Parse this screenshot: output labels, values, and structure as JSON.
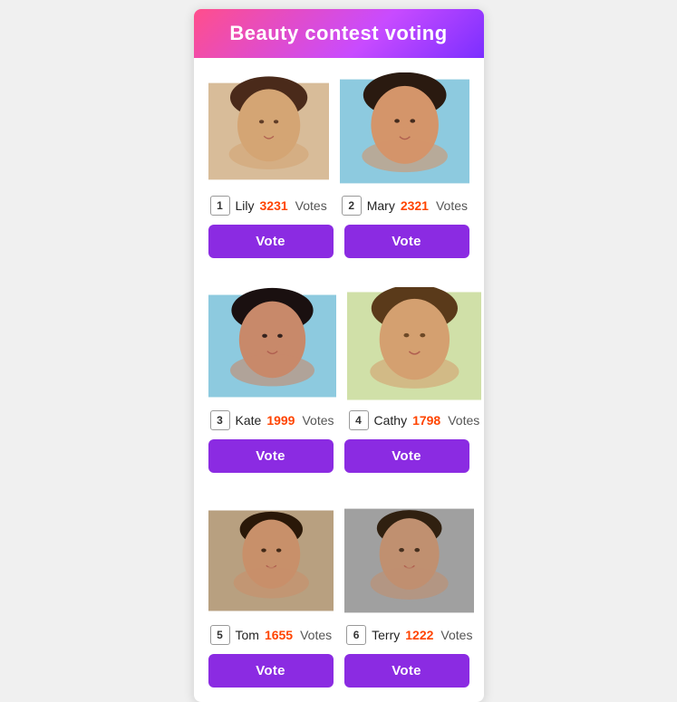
{
  "header": {
    "title": "Beauty contest voting",
    "gradient_start": "#ff4e8c",
    "gradient_end": "#7b2fff"
  },
  "candidates": [
    {
      "id": 1,
      "name": "Lily",
      "votes": 3231,
      "votes_label": "Votes",
      "photo_class": "photo-lily"
    },
    {
      "id": 2,
      "name": "Mary",
      "votes": 2321,
      "votes_label": "Votes",
      "photo_class": "photo-mary"
    },
    {
      "id": 3,
      "name": "Kate",
      "votes": 1999,
      "votes_label": "Votes",
      "photo_class": "photo-kate"
    },
    {
      "id": 4,
      "name": "Cathy",
      "votes": 1798,
      "votes_label": "Votes",
      "photo_class": "photo-cathy"
    },
    {
      "id": 5,
      "name": "Tom",
      "votes": 1655,
      "votes_label": "Votes",
      "photo_class": "photo-tom"
    },
    {
      "id": 6,
      "name": "Terry",
      "votes": 1222,
      "votes_label": "Votes",
      "photo_class": "photo-terry"
    }
  ],
  "vote_button_label": "Vote",
  "accent_color": "#8b2be2",
  "vote_count_color": "#ff4400"
}
